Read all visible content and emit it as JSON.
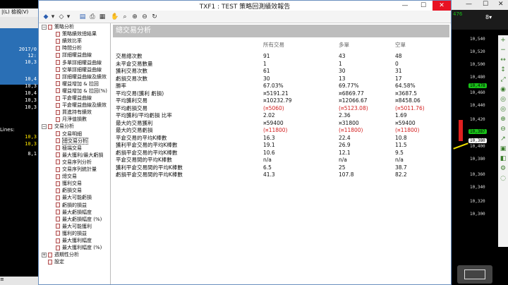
{
  "background_app": {
    "menu_left": "|(L)",
    "menu_right": "檢視(V)",
    "side_values": [
      "2017/0",
      "12:",
      "10,3",
      "10,4",
      "10,3",
      "10,4",
      "10,3",
      "10,3"
    ],
    "lines_label": "Lines:",
    "yellow_values": [
      "10,3",
      "10,3"
    ],
    "white_value": "8,1",
    "status_left": "≡"
  },
  "chart_panel": {
    "top_label": "476",
    "price_ticks": [
      "10,540",
      "10,520",
      "10,500",
      "10,480",
      "10,460",
      "10,440",
      "10,420",
      "10,400",
      "10,380",
      "10,360",
      "10,340",
      "10,320",
      "10,300"
    ],
    "green_marker": "10,478",
    "green_marker_2": "10,387",
    "white_marker": "10,380",
    "colors": {
      "accent_green": "#18c018",
      "tool_green": "#3a7d2b"
    }
  },
  "window": {
    "title": "TXF1 : TEST 策略回測績效報告",
    "minimize": "—",
    "maximize": "☐",
    "close": "✕"
  },
  "toolbar_icons": [
    "arrow-icon",
    "back-icon",
    "forward-icon",
    "save-icon",
    "print-icon",
    "find-icon",
    "hand-icon",
    "zoom-in-icon",
    "zoom-out-icon",
    "refresh-icon"
  ],
  "tree": {
    "items": [
      {
        "label": "策略分析",
        "level": 0,
        "expander": "−"
      },
      {
        "label": "策略績效總結果",
        "level": 1
      },
      {
        "label": "績效比率",
        "level": 1
      },
      {
        "label": "時間分析",
        "level": 1
      },
      {
        "label": "詳細權益曲線",
        "level": 1
      },
      {
        "label": "多單詳細權益曲線",
        "level": 1
      },
      {
        "label": "空單詳細權益曲線",
        "level": 1
      },
      {
        "label": "詳細權益曲線及績效",
        "level": 1
      },
      {
        "label": "權益增加 & 拉回",
        "level": 1
      },
      {
        "label": "權益增加 & 拉回(%)",
        "level": 1
      },
      {
        "label": "平倉權益曲線",
        "level": 1
      },
      {
        "label": "平倉權益曲線及績效",
        "level": 1
      },
      {
        "label": "買進持有績效",
        "level": 1
      },
      {
        "label": "月淨值損數",
        "level": 1
      },
      {
        "label": "交易分析",
        "level": 0,
        "expander": "−"
      },
      {
        "label": "交易明細",
        "level": 1
      },
      {
        "label": "總交易分析",
        "level": 1,
        "selected": true
      },
      {
        "label": "極端交易",
        "level": 1
      },
      {
        "label": "最大獲利/最大虧損",
        "level": 1
      },
      {
        "label": "交易序列分析",
        "level": 1
      },
      {
        "label": "交易序列統計量",
        "level": 1
      },
      {
        "label": "總交易",
        "level": 1
      },
      {
        "label": "獲利交易",
        "level": 1
      },
      {
        "label": "虧損交易",
        "level": 1
      },
      {
        "label": "最大可能虧損",
        "level": 1
      },
      {
        "label": "虧損的損益",
        "level": 1
      },
      {
        "label": "最大虧損幅度",
        "level": 1
      },
      {
        "label": "最大虧損幅度 (%)",
        "level": 1
      },
      {
        "label": "最大可能獲利",
        "level": 1
      },
      {
        "label": "獲利的損益",
        "level": 1
      },
      {
        "label": "最大獲利幅度",
        "level": 1
      },
      {
        "label": "最大獲利幅度 (%)",
        "level": 1
      },
      {
        "label": "週期性分析",
        "level": 0,
        "expander": "+"
      },
      {
        "label": "設定",
        "level": 0
      }
    ]
  },
  "report": {
    "section_title": "總交易分析",
    "columns": [
      "所有交易",
      "多單",
      "空單"
    ],
    "rows": [
      {
        "label": "交易總次數",
        "all": "91",
        "long": "43",
        "short": "48"
      },
      {
        "label": "未平倉交易數量",
        "all": "1",
        "long": "1",
        "short": "0"
      },
      {
        "label": "獲利交易次數",
        "all": "61",
        "long": "30",
        "short": "31"
      },
      {
        "label": "虧損交易次數",
        "all": "30",
        "long": "13",
        "short": "17"
      },
      {
        "label": "勝率",
        "all": "67.03%",
        "long": "69.77%",
        "short": "64.58%"
      },
      {
        "label": "平均交易(獲利 虧損)",
        "all": "¤5191.21",
        "long": "¤6869.77",
        "short": "¤3687.5"
      },
      {
        "label": "平均獲利交易",
        "all": "¤10232.79",
        "long": "¤12066.67",
        "short": "¤8458.06"
      },
      {
        "label": "平均虧損交易",
        "all": "(¤5060)",
        "long": "(¤5123.08)",
        "short": "(¤5011.76)",
        "negative": true
      },
      {
        "label": "平均獲利/平均虧損 比率",
        "all": "2.02",
        "long": "2.36",
        "short": "1.69"
      },
      {
        "label": "最大的交易獲利",
        "all": "¤59400",
        "long": "¤31800",
        "short": "¤59400"
      },
      {
        "label": "最大的交易虧損",
        "all": "(¤11800)",
        "long": "(¤11800)",
        "short": "(¤11800)",
        "negative": true
      },
      {
        "label": "平倉交易的平均K棒數",
        "all": "16.3",
        "long": "22.4",
        "short": "10.8"
      },
      {
        "label": "獲利平倉交易的平均K棒數",
        "all": "19.1",
        "long": "26.9",
        "short": "11.5"
      },
      {
        "label": "虧損平倉交易的平均K棒數",
        "all": "10.6",
        "long": "12.1",
        "short": "9.5"
      },
      {
        "label": "平倉交易間的平均K棒數",
        "all": "n/a",
        "long": "n/a",
        "short": "n/a"
      },
      {
        "label": "獲利平倉交易間的平均K棒數",
        "all": "6.5",
        "long": "25",
        "short": "38.7"
      },
      {
        "label": "虧損平倉交易間的平均K棒數",
        "all": "41.3",
        "long": "107.8",
        "short": "82.2"
      }
    ]
  }
}
